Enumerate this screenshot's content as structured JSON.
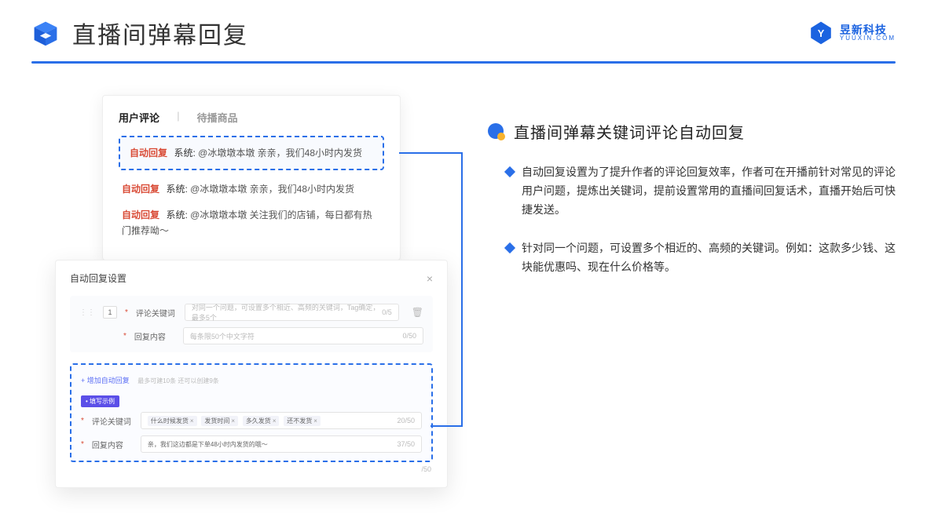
{
  "header": {
    "title": "直播间弹幕回复",
    "brand_name": "昱新科技",
    "brand_url": "YUUXIN.COM"
  },
  "comment_panel": {
    "tab_active": "用户评论",
    "tab_inactive": "待播商品",
    "rows": [
      {
        "tag": "自动回复",
        "sys": "系统: ",
        "text": "@冰墩墩本墩 亲亲，我们48小时内发货"
      },
      {
        "tag": "自动回复",
        "sys": "系统: ",
        "text": "@冰墩墩本墩 亲亲，我们48小时内发货"
      },
      {
        "tag": "自动回复",
        "sys": "系统: ",
        "text": "@冰墩墩本墩 关注我们的店铺，每日都有热门推荐呦～"
      }
    ]
  },
  "settings": {
    "title": "自动回复设置",
    "idx": "1",
    "field_keyword_label": "评论关键词",
    "field_keyword_placeholder": "对同一个问题，可设置多个相近、高频的关键词，Tag确定，最多5个",
    "field_keyword_count": "0/5",
    "field_reply_label": "回复内容",
    "field_reply_placeholder": "每条限50个中文字符",
    "field_reply_count": "0/50",
    "add_link": "+ 增加自动回复",
    "add_hint": "最多可建10条 还可以创建9条",
    "badge": "• 填写示例",
    "example": {
      "kw_label": "评论关键词",
      "tags": [
        "什么时候发货",
        "发货时间",
        "多久发货",
        "还不发货"
      ],
      "kw_count": "20/50",
      "reply_label": "回复内容",
      "reply_text": "亲，我们这边都是下单48小时内发货的哦～",
      "reply_count": "37/50"
    },
    "outer_count": "/50"
  },
  "right": {
    "section_title": "直播间弹幕关键词评论自动回复",
    "bullets": [
      "自动回复设置为了提升作者的评论回复效率，作者可在开播前针对常见的评论用户问题，提炼出关键词，提前设置常用的直播间回复话术，直播开始后可快捷发送。",
      "针对同一个问题，可设置多个相近的、高频的关键词。例如：这款多少钱、这块能优惠吗、现在什么价格等。"
    ]
  }
}
